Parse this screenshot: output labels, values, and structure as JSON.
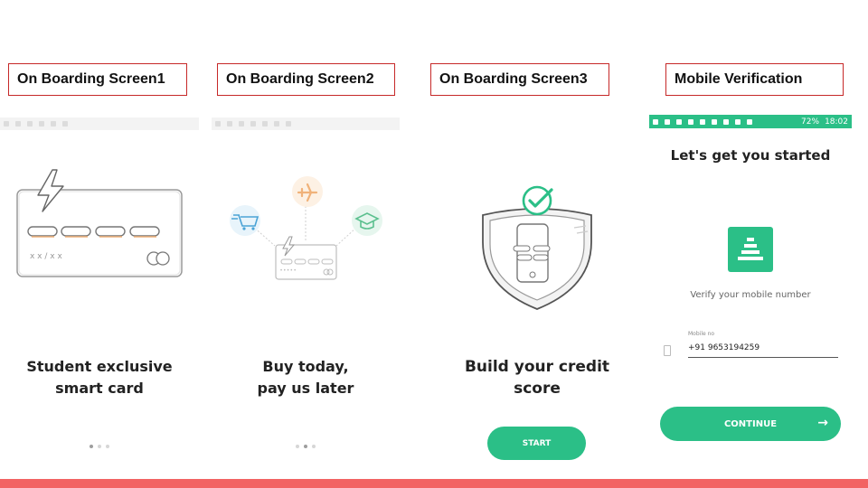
{
  "labels": {
    "screen1": "On Boarding Screen1",
    "screen2": "On Boarding Screen2",
    "screen3": "On Boarding Screen3",
    "screen4": "Mobile Verification"
  },
  "screen1": {
    "card_expiry": "x x / x x",
    "title_line1": "Student exclusive",
    "title_line2": "smart card",
    "page_indicator": {
      "current": 1,
      "total": 3
    }
  },
  "screen2": {
    "card_number_hint": "• • • • •",
    "title_line1": "Buy today,",
    "title_line2": "pay us later",
    "page_indicator": {
      "current": 2,
      "total": 3
    }
  },
  "screen3": {
    "title": "Build your credit score",
    "start_button": "START"
  },
  "screen4": {
    "status_bar": {
      "battery": "72%",
      "time": "18:02"
    },
    "heading": "Let's get you started",
    "verify_text": "Verify your mobile number",
    "mobile_field_label": "Mobile no",
    "mobile_value": "+91  9653194259",
    "continue_button": "CONTINUE"
  },
  "colors": {
    "brand_green": "#2bbf87",
    "label_border": "#c62828",
    "bottom_bar": "#f26363"
  },
  "icons": {
    "screen1": [
      "lightning-icon",
      "credit-card-icon"
    ],
    "screen2": [
      "shopping-cart-icon",
      "airplane-icon",
      "graduation-cap-icon",
      "lightning-icon",
      "credit-card-icon"
    ],
    "screen3": [
      "checkmark-icon",
      "shield-icon",
      "phone-icon"
    ],
    "screen4": [
      "stack-logo-icon",
      "phone-icon",
      "arrow-right-icon"
    ]
  }
}
